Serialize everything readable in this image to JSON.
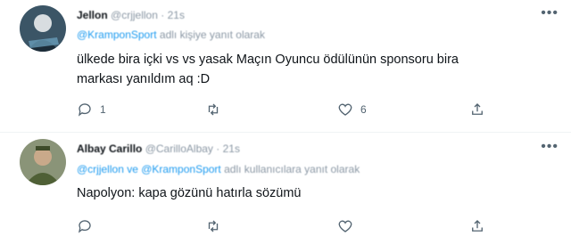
{
  "tweets": [
    {
      "name": "Jellon",
      "handle": "@crjjellon",
      "time": "21s",
      "reply_prefix": "",
      "reply_mentions": "@KramponSport",
      "reply_suffix": "adlı kişiye yanıt olarak",
      "text": "ülkede bira içki vs vs yasak Maçın Oyuncu ödülünün sponsoru bira markası yanıldım aq :D",
      "reply_count": "1",
      "retweet_count": "",
      "like_count": "6"
    },
    {
      "name": "Albay Carillo",
      "handle": "@CarilloAlbay",
      "time": "21s",
      "reply_prefix": "",
      "reply_mentions": "@crjjellon ve @KramponSport",
      "reply_suffix": "adlı kullanıcılara yanıt olarak",
      "text": "Napolyon: kapa gözünü hatırla sözümü",
      "reply_count": "",
      "retweet_count": "",
      "like_count": ""
    }
  ],
  "icons": {
    "more": "more-dots-icon",
    "reply": "reply-icon",
    "retweet": "retweet-icon",
    "like": "heart-icon",
    "share": "share-icon"
  },
  "colors": {
    "mention": "#1d9bf0",
    "secondary_text": "#536471"
  }
}
